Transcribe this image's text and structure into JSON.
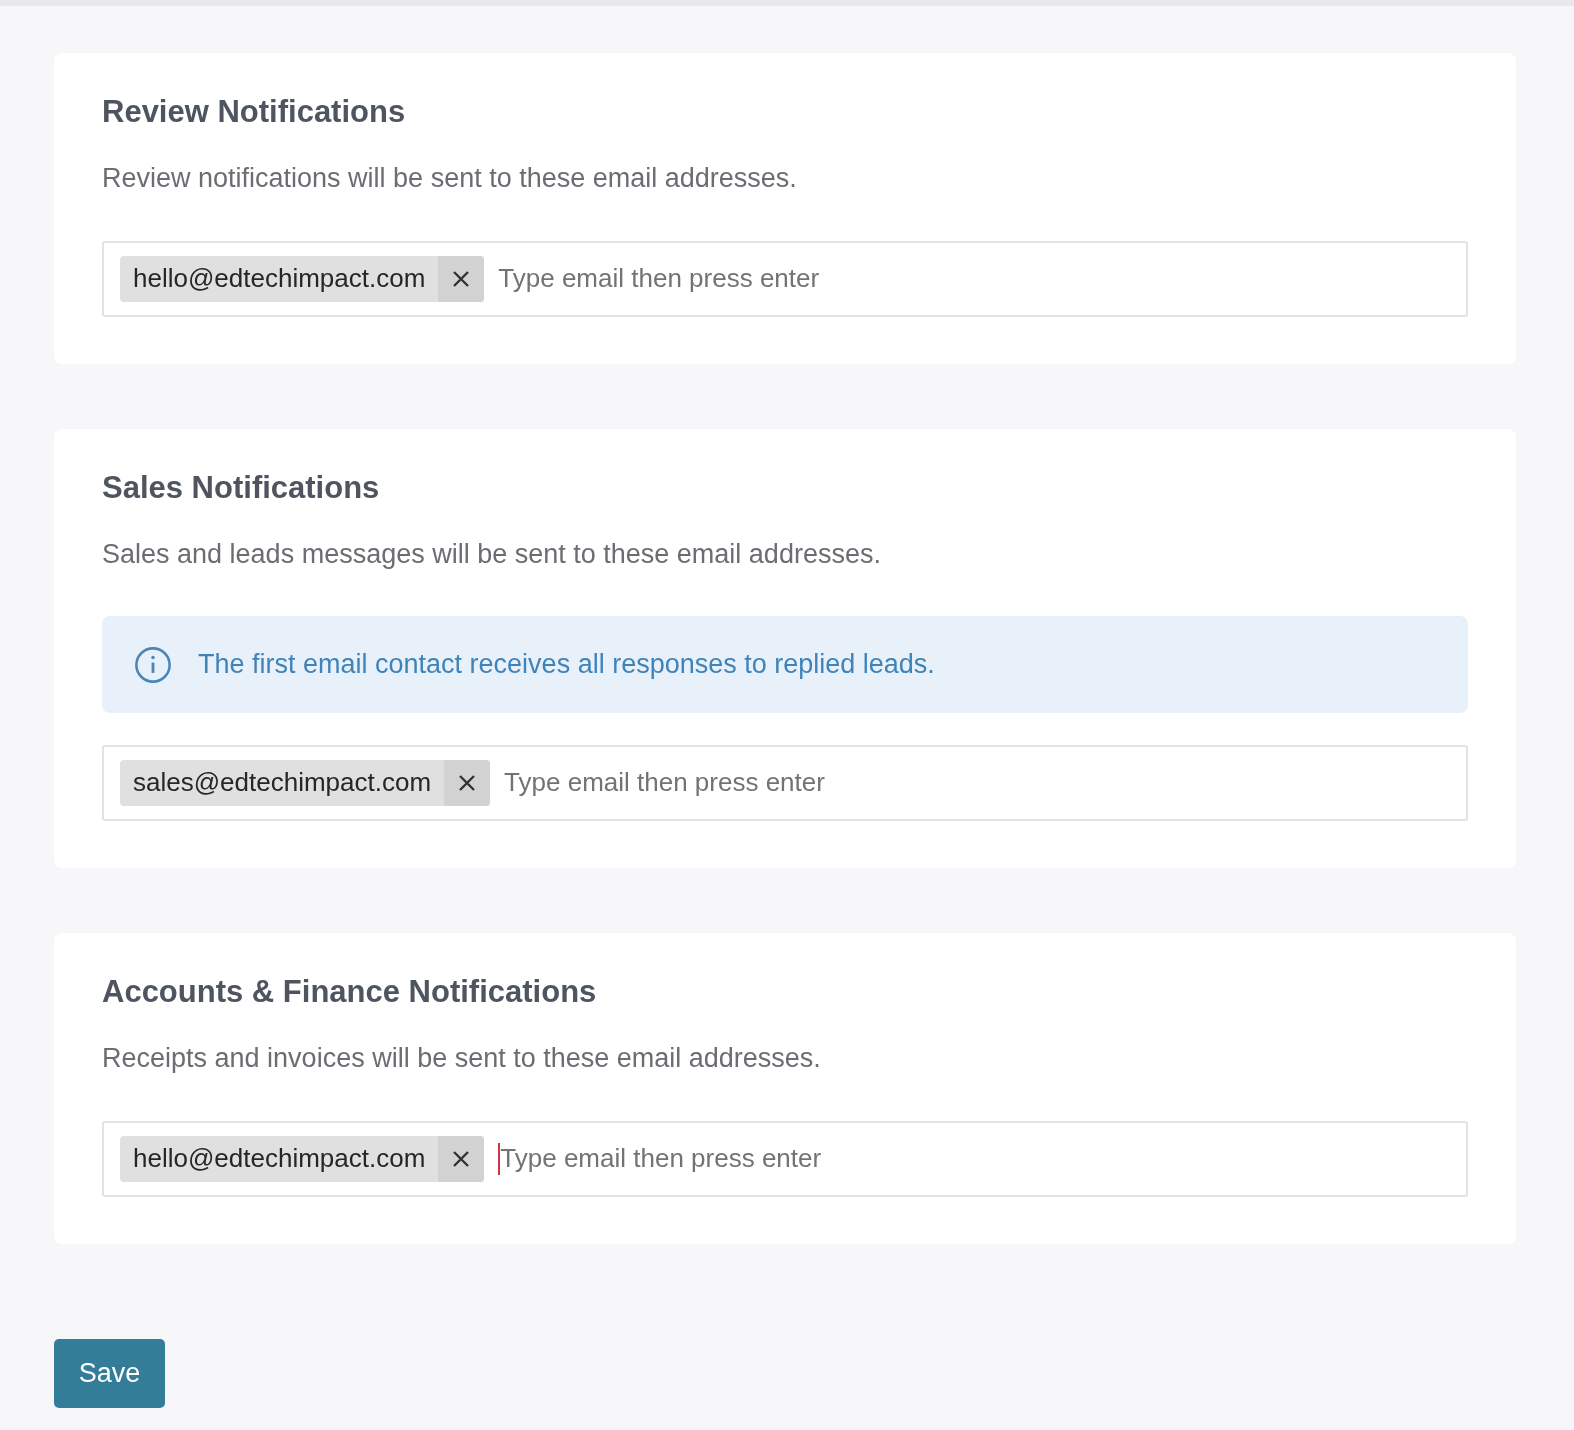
{
  "sections": [
    {
      "title": "Review Notifications",
      "description": "Review notifications will be sent to these email addresses.",
      "emails": [
        "hello@edtechimpact.com"
      ],
      "placeholder": "Type email then press enter",
      "focused": false
    },
    {
      "title": "Sales Notifications",
      "description": "Sales and leads messages will be sent to these email addresses.",
      "info": "The first email contact receives all responses to replied leads.",
      "emails": [
        "sales@edtechimpact.com"
      ],
      "placeholder": "Type email then press enter",
      "focused": false
    },
    {
      "title": "Accounts & Finance Notifications",
      "description": "Receipts and invoices will be sent to these email addresses.",
      "emails": [
        "hello@edtechimpact.com"
      ],
      "placeholder": "Type email then press enter",
      "focused": true
    }
  ],
  "save_button": "Save"
}
